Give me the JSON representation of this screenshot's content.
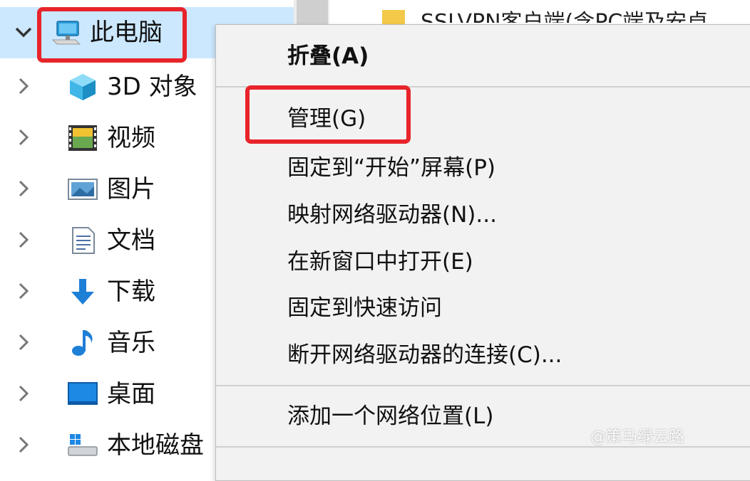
{
  "nav": {
    "root": {
      "label": "此电脑",
      "icon": "computer-icon",
      "expanded": true
    },
    "items": [
      {
        "label": "3D 对象",
        "icon": "3d-objects-icon"
      },
      {
        "label": "视频",
        "icon": "video-icon"
      },
      {
        "label": "图片",
        "icon": "pictures-icon"
      },
      {
        "label": "文档",
        "icon": "documents-icon"
      },
      {
        "label": "下载",
        "icon": "download-icon"
      },
      {
        "label": "音乐",
        "icon": "music-icon"
      },
      {
        "label": "桌面",
        "icon": "desktop-icon"
      },
      {
        "label": "本地磁盘",
        "icon": "local-disk-icon"
      }
    ]
  },
  "content": {
    "first_item_label": "SSLVPN客户端(含PC端及安卓"
  },
  "context_menu": {
    "items": [
      {
        "label": "折叠(A)",
        "bold": true
      },
      {
        "label": "管理(G)",
        "highlighted": true
      },
      {
        "label": "固定到“开始”屏幕(P)"
      },
      {
        "label": "映射网络驱动器(N)..."
      },
      {
        "label": "在新窗口中打开(E)"
      },
      {
        "label": "固定到快速访问"
      },
      {
        "label": "断开网络驱动器的连接(C)..."
      },
      {
        "label": "添加一个网络位置(L)"
      }
    ]
  },
  "watermark": "@策马绿云路",
  "colors": {
    "highlight_box": "#e8242a",
    "selection": "#cce8ff",
    "menu_bg": "#f2f2f2"
  }
}
